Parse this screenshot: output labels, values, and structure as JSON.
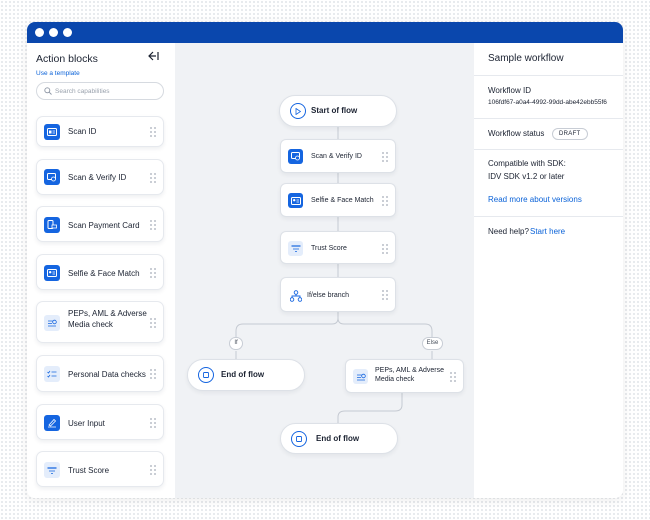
{
  "sidebar": {
    "title": "Action blocks",
    "collapse_icon": "collapse-left-icon",
    "template_link": "Use a template",
    "search_placeholder": "Search capabilities",
    "blocks": [
      {
        "label": "Scan ID",
        "icon": "id-card-icon",
        "style": "blue"
      },
      {
        "label": "Scan & Verify ID",
        "icon": "id-verify-icon",
        "style": "blue"
      },
      {
        "label": "Scan Payment Card",
        "icon": "payment-card-icon",
        "style": "blue"
      },
      {
        "label": "Selfie & Face Match",
        "icon": "selfie-icon",
        "style": "blue"
      },
      {
        "label": "PEPs, AML & Adverse Media check",
        "icon": "aml-check-icon",
        "style": "light"
      },
      {
        "label": "Personal Data checks",
        "icon": "data-check-icon",
        "style": "light"
      },
      {
        "label": "User Input",
        "icon": "user-input-icon",
        "style": "blue"
      },
      {
        "label": "Trust Score",
        "icon": "trust-score-icon",
        "style": "light"
      }
    ]
  },
  "flow": {
    "start": "Start of flow",
    "steps": [
      {
        "label": "Scan & Verify ID",
        "icon": "id-verify-icon"
      },
      {
        "label": "Selfie & Face Match",
        "icon": "selfie-icon"
      },
      {
        "label": "Trust Score",
        "icon": "trust-score-icon"
      }
    ],
    "branch": "If/else branch",
    "if_tag": "If",
    "else_tag": "Else",
    "end_left": "End of flow",
    "else_step": "PEPs, AML & Adverse Media check",
    "end_bottom": "End of flow"
  },
  "panel": {
    "title": "Sample workflow",
    "workflow_id_label": "Workflow ID",
    "workflow_id": "106fdf67-a0a4-4992-99dd-abe42ebb55f6",
    "status_label": "Workflow status",
    "status": "DRAFT",
    "sdk_label": "Compatible with SDK:",
    "sdk_value": "IDV SDK v1.2 or later",
    "versions_link": "Read more about versions",
    "help_label": "Need help?",
    "help_link": "Start here"
  },
  "colors": {
    "brand": "#0a47ad",
    "accent": "#1565e0",
    "link": "#0a62d8"
  }
}
